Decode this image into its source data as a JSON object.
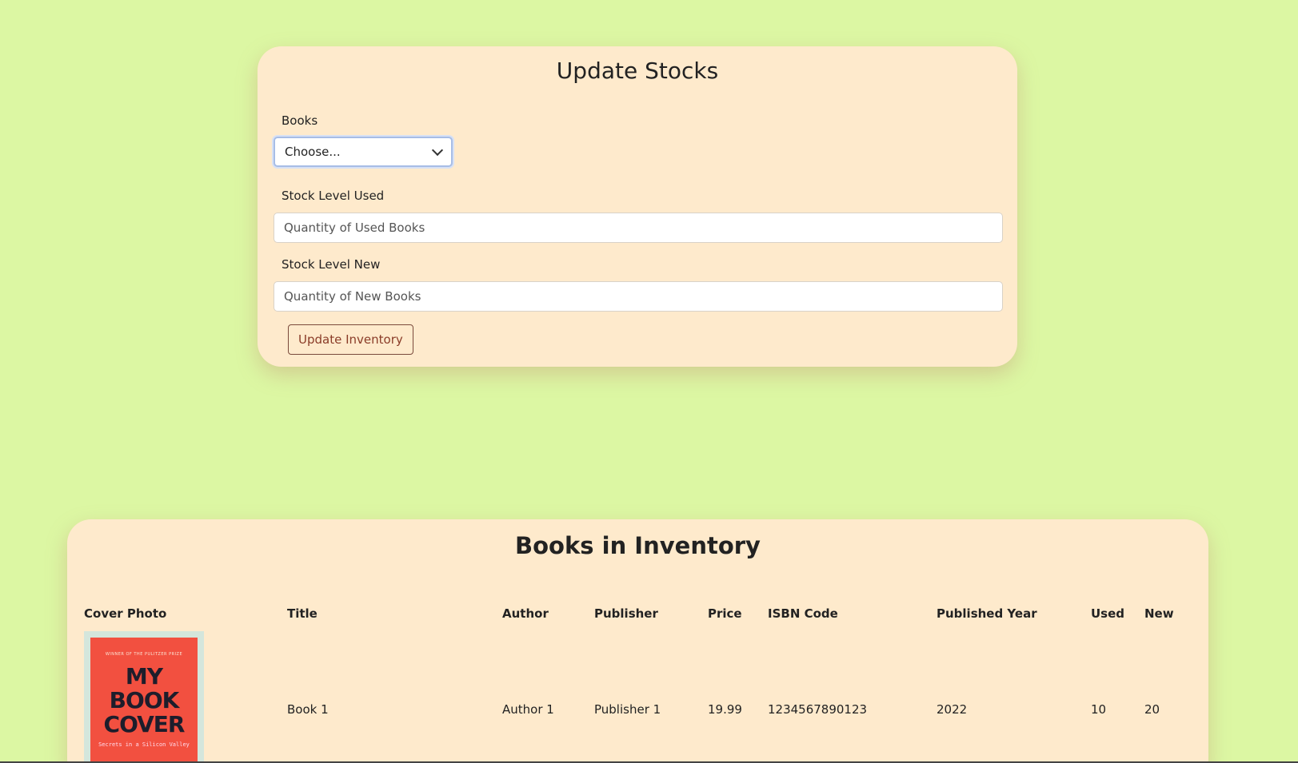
{
  "update_form": {
    "title": "Update Stocks",
    "books_label": "Books",
    "books_select_value": "Choose...",
    "used_label": "Stock Level Used",
    "used_placeholder": "Quantity of Used Books",
    "new_label": "Stock Level New",
    "new_placeholder": "Quantity of New Books",
    "submit_label": "Update Inventory"
  },
  "inventory": {
    "title": "Books in Inventory",
    "columns": [
      "Cover Photo",
      "Title",
      "Author",
      "Publisher",
      "Price",
      "ISBN Code",
      "Published Year",
      "Used",
      "New"
    ],
    "rows": [
      {
        "cover": {
          "award": "WINNER OF THE PULITZER PRIZE",
          "title_line1": "MY",
          "title_line2": "BOOK",
          "title_line3": "COVER",
          "subtitle": "Secrets in a Silicon Valley"
        },
        "title": "Book 1",
        "author": "Author 1",
        "publisher": "Publisher 1",
        "price": "19.99",
        "isbn": "1234567890123",
        "year": "2022",
        "used": "10",
        "new": "20"
      }
    ]
  },
  "colors": {
    "page_background": "#dcf7a3",
    "card_background": "#feeacc",
    "button_text": "#8a3c28",
    "cover_red": "#f25040"
  }
}
